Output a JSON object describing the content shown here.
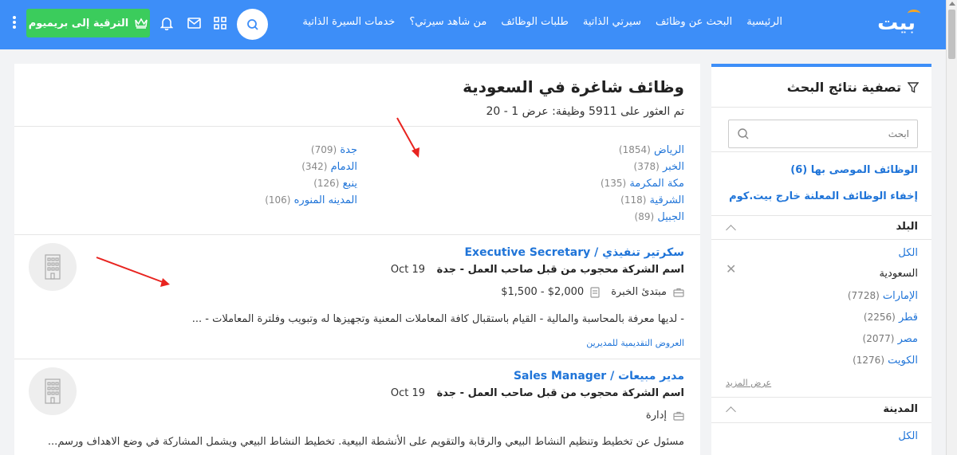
{
  "header": {
    "logo": "بيت",
    "nav": [
      "الرئيسية",
      "البحث عن وظائف",
      "سيرتي الذاتية",
      "طلبات الوظائف",
      "من شاهد سيرتي؟",
      "خدمات السيرة الذاتية"
    ],
    "premium_label": "الترقية إلى بريميوم"
  },
  "sidebar": {
    "title": "تصفية نتائج البحث",
    "search_placeholder": "ابحث",
    "recommended": "الوظائف الموصى بها (6)",
    "hide_external": "إخفاء الوظائف المعلنة خارج بيت.كوم",
    "country_section": "البلد",
    "countries": [
      {
        "name": "الكل",
        "count": ""
      },
      {
        "name": "السعودية",
        "count": ""
      },
      {
        "name": "الإمارات",
        "count": "(7728)"
      },
      {
        "name": "قطر",
        "count": "(2256)"
      },
      {
        "name": "مصر",
        "count": "(2077)"
      },
      {
        "name": "الكويت",
        "count": "(1276)"
      }
    ],
    "more": "عرض المزيد",
    "city_section": "المدينة",
    "city_all": "الكل"
  },
  "main": {
    "title": "وظائف شاغرة في السعودية",
    "subtitle": "تم العثور على 5911 وظيفة: عرض 1 - 20",
    "cities_right": [
      {
        "name": "الرياض",
        "count": "(1854)"
      },
      {
        "name": "الخبر",
        "count": "(378)"
      },
      {
        "name": "مكة المكرمة",
        "count": "(135)"
      },
      {
        "name": "الشرقية",
        "count": "(118)"
      },
      {
        "name": "الجبيل",
        "count": "(89)"
      }
    ],
    "cities_left": [
      {
        "name": "جدة",
        "count": "(709)"
      },
      {
        "name": "الدمام",
        "count": "(342)"
      },
      {
        "name": "ينبع",
        "count": "(126)"
      },
      {
        "name": "المدينه المنوره",
        "count": "(106)"
      }
    ]
  },
  "jobs": [
    {
      "title": "سكرتير تنفيذي / Executive Secretary",
      "company": "اسم الشركة محجوب من قبل صاحب العمل - جدة",
      "date": "Oct 19",
      "level": "مبتدئ الخبرة",
      "salary": "$1,500 - $2,000",
      "desc": "-    لديها معرفة بالمحاسبة والمالية     -    القيام باستقبال كافة المعاملات المعنية وتجهيزها له وتبويب وفلترة المعاملات -    ...",
      "tag": "العروض التقديمية للمديرين"
    },
    {
      "title": "مدير مبيعات / Sales Manager",
      "company": "اسم الشركة محجوب من قبل صاحب العمل - جدة",
      "date": "Oct 19",
      "level": "إدارة",
      "desc": "مسئول عن تخطيط وتنظيم النشاط البيعي والرقابة والتقويم على الأنشطة البيعية. تخطيط النشاط البيعي ويشمل المشاركة في وضع الاهداف ورسم..."
    }
  ],
  "colors": {
    "header": "#3d8ef8",
    "premium": "#3bcc5c",
    "link": "#1f74d8",
    "arrow": "#e8231f"
  }
}
